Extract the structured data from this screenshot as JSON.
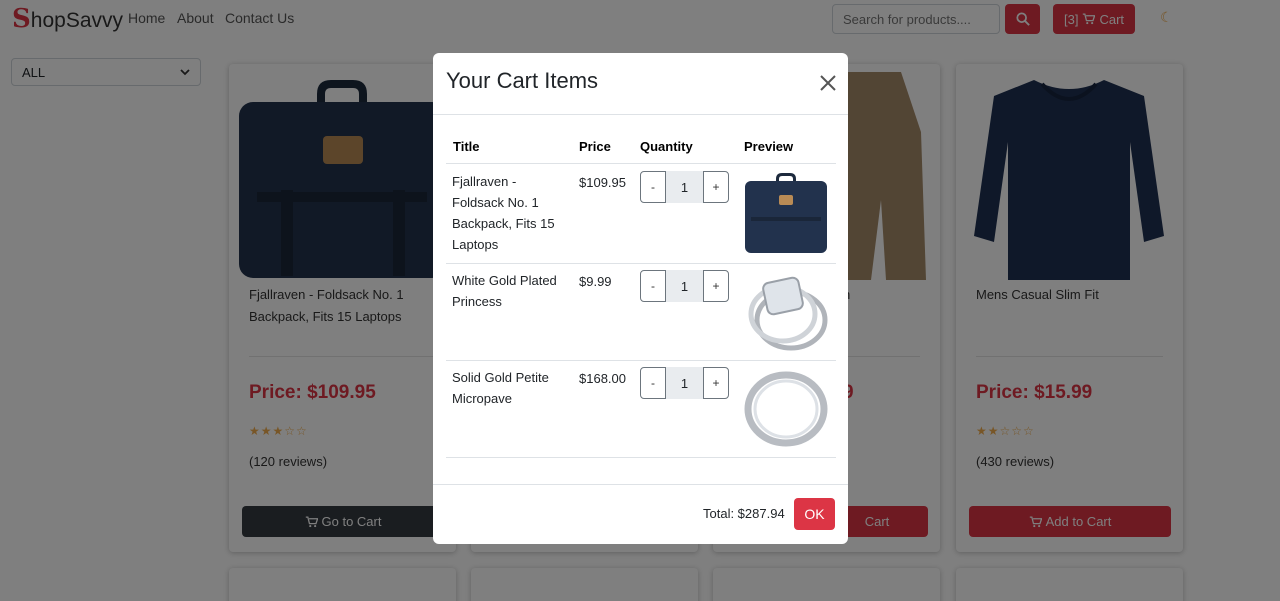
{
  "navbar": {
    "brand_initial": "S",
    "brand_rest": "hopSavvy",
    "links": [
      "Home",
      "About",
      "Contact Us"
    ],
    "search_placeholder": "Search for products....",
    "cart_count": "[3]",
    "cart_label": "Cart",
    "icons": [
      "search-icon",
      "cart-icon",
      "moon-icon"
    ],
    "accent_color": "#dc3545"
  },
  "sidebar": {
    "category_value": "ALL"
  },
  "products": [
    {
      "title": "Fjallraven - Foldsack No. 1 Backpack, Fits 15 Laptops",
      "price": "Price: $109.95",
      "stars": "★★★☆☆",
      "reviews": "(120 reviews)",
      "button": "Go to Cart",
      "button_color": "#343a40"
    },
    {
      "title": "",
      "price": "",
      "stars": "",
      "reviews": "",
      "button": "",
      "button_color": "#dc3545"
    },
    {
      "title": "n",
      "price": "9",
      "stars": "",
      "reviews": "",
      "button": "Cart",
      "button_color": "#dc3545"
    },
    {
      "title": "Mens Casual Slim Fit",
      "price": "Price: $15.99",
      "stars": "★★☆☆☆",
      "reviews": "(430 reviews)",
      "button": "Add to Cart",
      "button_color": "#dc3545"
    }
  ],
  "modal": {
    "title": "Your Cart Items",
    "headers": [
      "Title",
      "Price",
      "Quantity",
      "Preview"
    ],
    "items": [
      {
        "title": "Fjallraven - Foldsack No. 1 Backpack, Fits 15 Laptops",
        "price": "$109.95",
        "qty_minus": "-",
        "quantity": "1",
        "qty_plus": "+"
      },
      {
        "title": "White Gold Plated Princess",
        "price": "$9.99",
        "qty_minus": "-",
        "quantity": "1",
        "qty_plus": "+"
      },
      {
        "title": "Solid Gold Petite Micropave",
        "price": "$168.00",
        "qty_minus": "-",
        "quantity": "1",
        "qty_plus": "+"
      }
    ],
    "total": "Total: $287.94",
    "ok_label": "OK"
  }
}
